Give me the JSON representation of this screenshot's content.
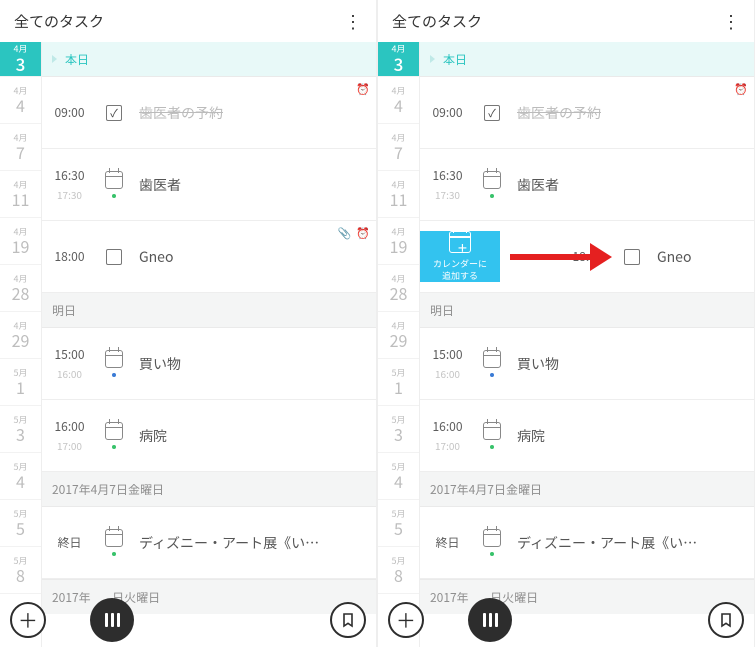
{
  "header": {
    "title": "全てのタスク"
  },
  "rail": [
    {
      "month": "4月",
      "day": "3",
      "today": true
    },
    {
      "month": "4月",
      "day": "4"
    },
    {
      "month": "4月",
      "day": "7"
    },
    {
      "month": "4月",
      "day": "11"
    },
    {
      "month": "4月",
      "day": "19"
    },
    {
      "month": "4月",
      "day": "28"
    },
    {
      "month": "4月",
      "day": "29"
    },
    {
      "month": "5月",
      "day": "1"
    },
    {
      "month": "5月",
      "day": "3"
    },
    {
      "month": "5月",
      "day": "4"
    },
    {
      "month": "5月",
      "day": "5"
    },
    {
      "month": "5月",
      "day": "8"
    }
  ],
  "sections": {
    "today": "本日",
    "tomorrow": "明日",
    "date1": "2017年4月7日金曜日",
    "date2": "日火曜日",
    "date2_prefix": "2017年"
  },
  "tasks": {
    "dentist_appt": {
      "time": "09:00",
      "title": "歯医者の予約",
      "done": true,
      "alarm": true
    },
    "dentist": {
      "time": "16:30",
      "time2": "17:30",
      "title": "歯医者",
      "dot": "green"
    },
    "gneo": {
      "time": "18:00",
      "title": "Gneo",
      "clip": true,
      "alarm": true
    },
    "shopping": {
      "time": "15:00",
      "time2": "16:00",
      "title": "買い物",
      "dot": "blue"
    },
    "hospital": {
      "time": "16:00",
      "time2": "17:00",
      "title": "病院",
      "dot": "green"
    },
    "disney": {
      "time": "終日",
      "title": "ディズニー・アート展《い…",
      "dot": "green"
    }
  },
  "swipe": {
    "label1": "カレンダーに",
    "label2": "追加する"
  }
}
